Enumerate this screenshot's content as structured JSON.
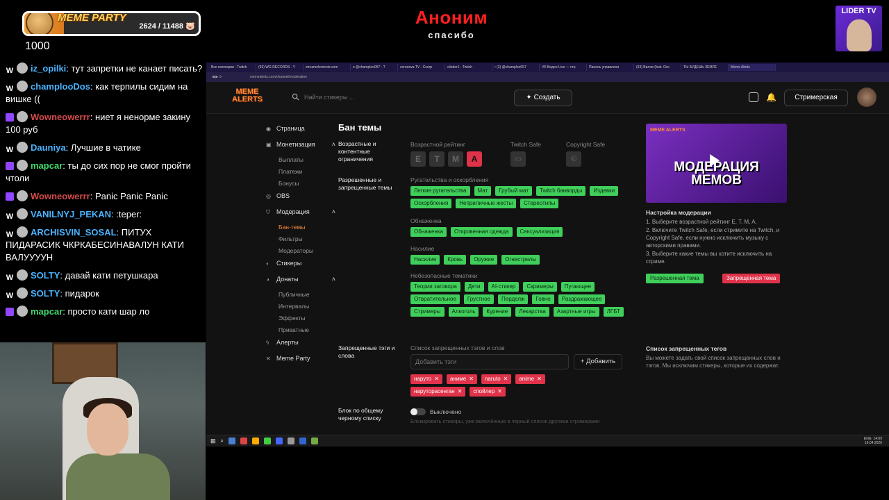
{
  "overlay": {
    "party_title": "MEME PARTY",
    "party_count": "2624 / 11488",
    "party_progress": 0.228,
    "party_level": "1000",
    "donor_name": "Аноним",
    "donor_thanks": "спасибо",
    "channel_logo": "LIDER TV"
  },
  "chat": [
    {
      "badge": "W",
      "nick": "iz_opilki",
      "color": "#4ab3ff",
      "text": "тут запретки не канает писать?"
    },
    {
      "badge": "W",
      "nick": "champlooDos",
      "color": "#4ab3ff",
      "text": "как терпилы сидим на вишке (("
    },
    {
      "badge": "tw",
      "nick": "Wowneowerrr",
      "color": "#d44a4a",
      "text": "ниет я ненорме закину 100 руб"
    },
    {
      "badge": "W",
      "nick": "Dauniya",
      "color": "#4ab3ff",
      "text": "Лучшие в чатике"
    },
    {
      "badge": "tw",
      "nick": "mapcar",
      "color": "#3fd96a",
      "text": "ты до сих пор не смог пройти чтоли"
    },
    {
      "badge": "tw",
      "nick": "Wowneowerrr",
      "color": "#d44a4a",
      "text": "Panic Panic Panic"
    },
    {
      "badge": "W",
      "nick": "VANILNYJ_PEKAN",
      "color": "#4ab3ff",
      "text": ":teper:"
    },
    {
      "badge": "W",
      "nick": "ARCHISVIN_SOSAL",
      "color": "#4ab3ff",
      "text": "ПИТУХ ПИДАРАСИК ЧКРКАБЕСИНАВАЛУН КАТИ ВАЛУУУУН"
    },
    {
      "badge": "W",
      "nick": "SOLTY",
      "color": "#4ab3ff",
      "text": "давай кати петушкара"
    },
    {
      "badge": "W",
      "nick": "SOLTY",
      "color": "#4ab3ff",
      "text": "пидарок"
    },
    {
      "badge": "tw",
      "nick": "mapcar",
      "color": "#3fd96a",
      "text": "просто кати шар ло"
    }
  ],
  "browser": {
    "tabs": [
      "Все категории - Twitch",
      "(93) WG RECORDS - Y",
      "streamelements.com",
      "e @champloo057 - T",
      "cornoova TV - Cxorp",
      "clieder1 - Twitch",
      "• (3) @champloo057",
      "VK Видео Live — стр",
      "Панель управлени",
      "(93) Вилов (feat. Osc",
      "ТЫ БУДЕШЬ ЗЕМЛЕ",
      "Meme Alerts"
    ],
    "active_tab": 11,
    "url": "memealerts.com/channel/moderation"
  },
  "app": {
    "logo": "MEME ALERTS",
    "search_placeholder": "Найти стикеры ...",
    "create_label": "Создать",
    "streamer_label": "Стримерская",
    "sidebar": {
      "page": "Страница",
      "monetization": "Монетизация",
      "payouts": "Выплаты",
      "payments": "Платежи",
      "bonuses": "Бонусы",
      "obs": "OBS",
      "moderation": "Модерация",
      "ban_topics": "Бан-темы",
      "filters": "Фильтры",
      "moderators": "Модераторы",
      "stickers": "Стикеры",
      "donations": "Донаты",
      "public": "Публичные",
      "intervals": "Интервалы",
      "effects": "Эффекты",
      "private": "Приватные",
      "alerts": "Алерты",
      "meme_party": "Meme Party"
    },
    "main": {
      "title": "Бан темы",
      "age_section": "Возрастные и контентные ограничения",
      "age_rating_label": "Возрастной рейтинг",
      "ratings": [
        "E",
        "T",
        "M",
        "A"
      ],
      "active_rating": "A",
      "twitch_safe_label": "Twitch Safe",
      "copyright_safe_label": "Copyright Safe",
      "topics_section": "Разрешенные и запрещенные темы",
      "group_1": "Ругательства и оскорбления",
      "group_1_chips": [
        {
          "label": "Легкие ругательства",
          "state": "allowed"
        },
        {
          "label": "Мат",
          "state": "allowed"
        },
        {
          "label": "Грубый мат",
          "state": "allowed"
        },
        {
          "label": "Twitch банворды",
          "state": "allowed"
        },
        {
          "label": "Издевки",
          "state": "allowed"
        },
        {
          "label": "Оскорбления",
          "state": "allowed"
        },
        {
          "label": "Неприличные жесты",
          "state": "allowed"
        },
        {
          "label": "Стереотипы",
          "state": "allowed"
        }
      ],
      "group_2": "Обнаженка",
      "group_2_chips": [
        {
          "label": "Обнаженка",
          "state": "allowed"
        },
        {
          "label": "Откровенная одежда",
          "state": "allowed"
        },
        {
          "label": "Сексуализация",
          "state": "allowed"
        }
      ],
      "group_3": "Насилие",
      "group_3_chips": [
        {
          "label": "Насилие",
          "state": "allowed"
        },
        {
          "label": "Кровь",
          "state": "allowed"
        },
        {
          "label": "Оружие",
          "state": "allowed"
        },
        {
          "label": "Огнестрелы",
          "state": "allowed"
        }
      ],
      "group_4": "Небезопасные тематики",
      "group_4_chips": [
        {
          "label": "Теории заговора",
          "state": "allowed"
        },
        {
          "label": "Дети",
          "state": "allowed"
        },
        {
          "label": "AI-стикер",
          "state": "allowed"
        },
        {
          "label": "Скримеры",
          "state": "allowed"
        },
        {
          "label": "Пугающее",
          "state": "allowed"
        },
        {
          "label": "Отвратительное",
          "state": "allowed"
        },
        {
          "label": "Грустное",
          "state": "allowed"
        },
        {
          "label": "Перделж",
          "state": "allowed"
        },
        {
          "label": "Говно",
          "state": "allowed"
        },
        {
          "label": "Раздражающее",
          "state": "allowed"
        },
        {
          "label": "Стримеры",
          "state": "allowed"
        },
        {
          "label": "Алкоголь",
          "state": "allowed"
        },
        {
          "label": "Курение",
          "state": "allowed"
        },
        {
          "label": "Лекарства",
          "state": "allowed"
        },
        {
          "label": "Азартные игры",
          "state": "allowed"
        },
        {
          "label": "ЛГБТ",
          "state": "allowed"
        }
      ],
      "tags_section": "Запрещенные тэги и слова",
      "tags_list_label": "Список запрещенных тэгов и слов",
      "tags_placeholder": "Добавить тэги",
      "add_label": "Добавить",
      "banned_tags": [
        "наруто",
        "аниме",
        "naruto",
        "anime",
        "наруторасенган",
        "спойлер"
      ],
      "blacklist_section": "Блок по общему черному списку",
      "blacklist_state": "Выключено",
      "blacklist_hint": "Блокировать стикеры, уже включённые в черный список другими стримерами"
    },
    "right": {
      "video_logo": "MEME ALERTS",
      "video_title_1": "МОДЕРАЦИЯ",
      "video_title_2": "МЕМОВ",
      "help_title": "Настройка модерации",
      "help_items": [
        "1. Выберите возрастной рейтинг E, T, M, A.",
        "2. Включите Twitch Safe, если стримите на Twitch, и Copyright Safe, если нужно исключить музыку с авторскими правами.",
        "3. Выберите какие темы вы хотите исключить на стриме."
      ],
      "legend_allowed": "Разрешенная тема",
      "legend_banned": "Запрещенная тема",
      "tags_title": "Список запрещенных тегов",
      "tags_desc": "Вы можете задать свой список запрещенных слов и тэгов. Мы исключим стикеры, которые их содержат."
    },
    "taskbar": {
      "lang": "ENG",
      "time": "14:09",
      "date": "19.04.2026"
    }
  }
}
